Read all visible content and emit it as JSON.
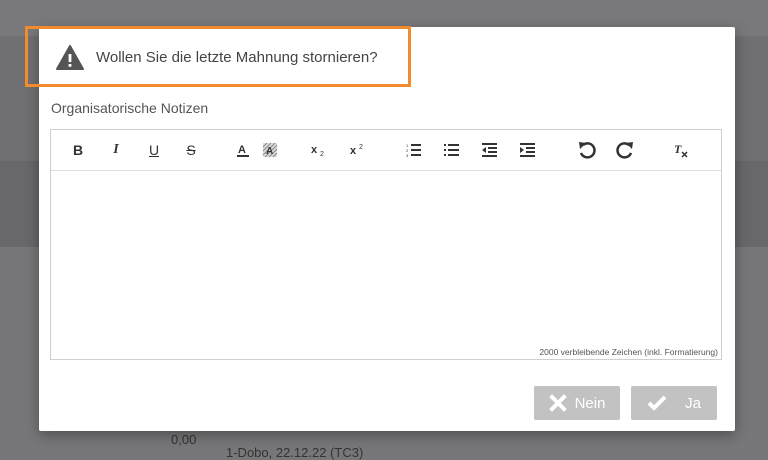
{
  "background": {
    "amount": "0,00",
    "amount2": "0,00",
    "reference": "1-Dobo, 22.12.22 (TC3)"
  },
  "dialog": {
    "title": "Wollen Sie die letzte Mahnung stornieren?",
    "notes_label": "Organisatorische Notizen",
    "char_counter": "2000 verbleibende Zeichen (inkl. Formatierung)",
    "toolbar": {
      "bold": "B",
      "italic": "I",
      "underline": "U",
      "strike": "S"
    },
    "buttons": {
      "no_label": "Nein",
      "yes_label": "Ja"
    }
  },
  "colors": {
    "highlight": "#f28a2e",
    "button_bg": "#c2c2c2",
    "overlay": "#7b7b7e"
  }
}
